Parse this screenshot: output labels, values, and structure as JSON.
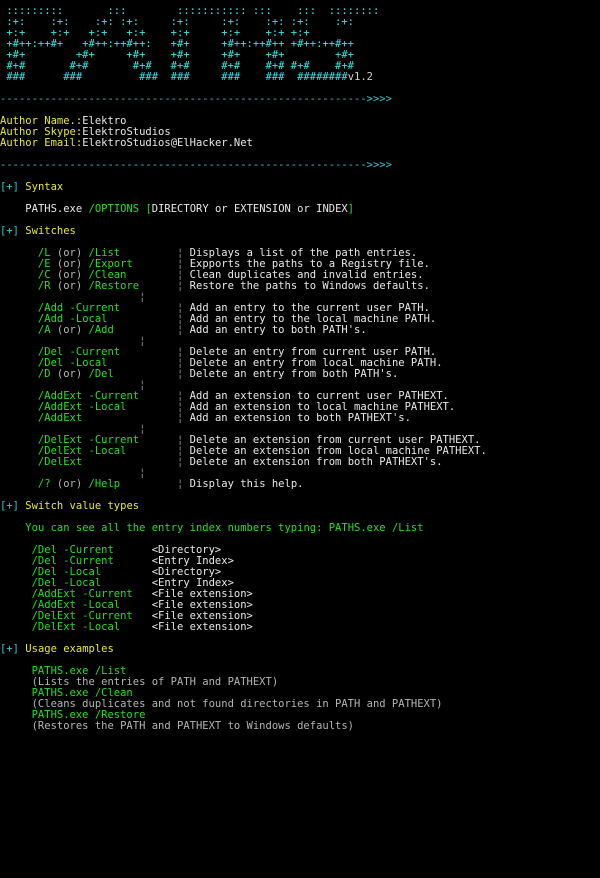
{
  "app": {
    "name": "PATHS.exe",
    "version_label": "v1.2",
    "logo_lines": [
      " :::::::::       :::        ::::::::::: :::    :::  ::::::::",
      " :+:    :+:    :+: :+:     :+:     :+:    :+: :+:    :+:",
      " +:+    +:+   +:+   +:+    +:+     +:+    +:+ +:+",
      " +#++:++#+   +#++:++#++:   +#+     +#++:++#++ +#++:++#++",
      " +#+        +#+     +#+    +#+     +#+    +#+        +#+",
      " #+#       #+#       #+#   #+#     #+#    #+# #+#    #+#",
      " ###      ###         ###  ###     ###    ###  ########"
    ]
  },
  "divider": {
    "line": "---------------------------------------------------------->>>>"
  },
  "author": {
    "name_label": "Author Name.:",
    "name_value": "Elektro",
    "skype_label": "Author Skype:",
    "skype_value": "ElektroStudios",
    "email_label": "Author Email:",
    "email_value": "ElektroStudios@ElHacker.Net"
  },
  "sections": {
    "tag_open": "[+]",
    "syntax_title": "Syntax",
    "switches_title": "Switches",
    "value_types_title": "Switch value types",
    "usage_title": "Usage examples"
  },
  "syntax": {
    "program": "PATHS.exe",
    "options": "/OPTIONS",
    "bracket_open": "[",
    "argument": "DIRECTORY or EXTENSION or INDEX",
    "bracket_close": "]"
  },
  "switches": {
    "separator": "¦",
    "groups": [
      {
        "rows": [
          {
            "switch": "/L",
            "or": "(or)",
            "alias": "/List",
            "desc": "Displays a list of the path entries."
          },
          {
            "switch": "/E",
            "or": "(or)",
            "alias": "/Export",
            "desc": "Expports the paths to a Registry file."
          },
          {
            "switch": "/C",
            "or": "(or)",
            "alias": "/Clean",
            "desc": "Clean duplicates and invalid entries."
          },
          {
            "switch": "/R",
            "or": "(or)",
            "alias": "/Restore",
            "desc": "Restore the paths to Windows defaults."
          }
        ]
      },
      {
        "rows": [
          {
            "switch": "/Add",
            "or": "",
            "alias": "-Current",
            "desc": "Add an entry to the current user PATH."
          },
          {
            "switch": "/Add",
            "or": "",
            "alias": "-Local",
            "desc": "Add an entry to the local machine PATH."
          },
          {
            "switch": "/A",
            "or": "(or)",
            "alias": "/Add",
            "desc": "Add an entry to both PATH's."
          }
        ]
      },
      {
        "rows": [
          {
            "switch": "/Del",
            "or": "",
            "alias": "-Current",
            "desc": "Delete an entry from current user PATH."
          },
          {
            "switch": "/Del",
            "or": "",
            "alias": "-Local",
            "desc": "Delete an entry from local machine PATH."
          },
          {
            "switch": "/D",
            "or": "(or)",
            "alias": "/Del",
            "desc": "Delete an entry from both PATH's."
          }
        ]
      },
      {
        "rows": [
          {
            "switch": "/AddExt",
            "or": "",
            "alias": "-Current",
            "desc": "Add an extension to current user PATHEXT."
          },
          {
            "switch": "/AddExt",
            "or": "",
            "alias": "-Local",
            "desc": "Add an extension to local machine PATHEXT."
          },
          {
            "switch": "/AddExt",
            "or": "",
            "alias": "",
            "desc": "Add an extension to both PATHEXT's."
          }
        ]
      },
      {
        "rows": [
          {
            "switch": "/DelExt",
            "or": "",
            "alias": "-Current",
            "desc": "Delete an extension from current user PATHEXT."
          },
          {
            "switch": "/DelExt",
            "or": "",
            "alias": "-Local",
            "desc": "Delete an extension from local machine PATHEXT."
          },
          {
            "switch": "/DelExt",
            "or": "",
            "alias": "",
            "desc": "Delete an extension from both PATHEXT's."
          }
        ]
      },
      {
        "rows": [
          {
            "switch": "/?",
            "or": "(or)",
            "alias": "/Help",
            "desc": "Display this help."
          }
        ]
      }
    ]
  },
  "value_types": {
    "note": "You can see all the entry index numbers typing: PATHS.exe /List",
    "groups": [
      {
        "rows": [
          {
            "switch": "/Del -Current",
            "value": "<Directory>"
          },
          {
            "switch": "/Del -Current",
            "value": "<Entry Index>"
          }
        ]
      },
      {
        "rows": [
          {
            "switch": "/Del -Local",
            "value": "<Directory>"
          },
          {
            "switch": "/Del -Local",
            "value": "<Entry Index>"
          }
        ]
      },
      {
        "rows": [
          {
            "switch": "/AddExt -Current",
            "value": "<File extension>"
          },
          {
            "switch": "/AddExt -Local",
            "value": "<File extension>"
          }
        ]
      },
      {
        "rows": [
          {
            "switch": "/DelExt -Current",
            "value": "<File extension>"
          },
          {
            "switch": "/DelExt -Local",
            "value": "<File extension>"
          }
        ]
      }
    ]
  },
  "usage": {
    "examples": [
      {
        "command": "PATHS.exe /List",
        "desc": "(Lists the entries of PATH and PATHEXT)"
      },
      {
        "command": "PATHS.exe /Clean",
        "desc": "(Cleans duplicates and not found directories in PATH and PATHEXT)"
      },
      {
        "command": "PATHS.exe /Restore",
        "desc": "(Restores the PATH and PATHEXT to Windows defaults)"
      }
    ]
  },
  "colors": {
    "background": "#000000",
    "banner": "#31e7e7",
    "divider": "#31c7d4",
    "section_tag": "#31c7d4",
    "section_title": "#e8e82a",
    "switch": "#1ee21e",
    "description": "#e8e8e8",
    "muted": "#b4b4b4"
  }
}
